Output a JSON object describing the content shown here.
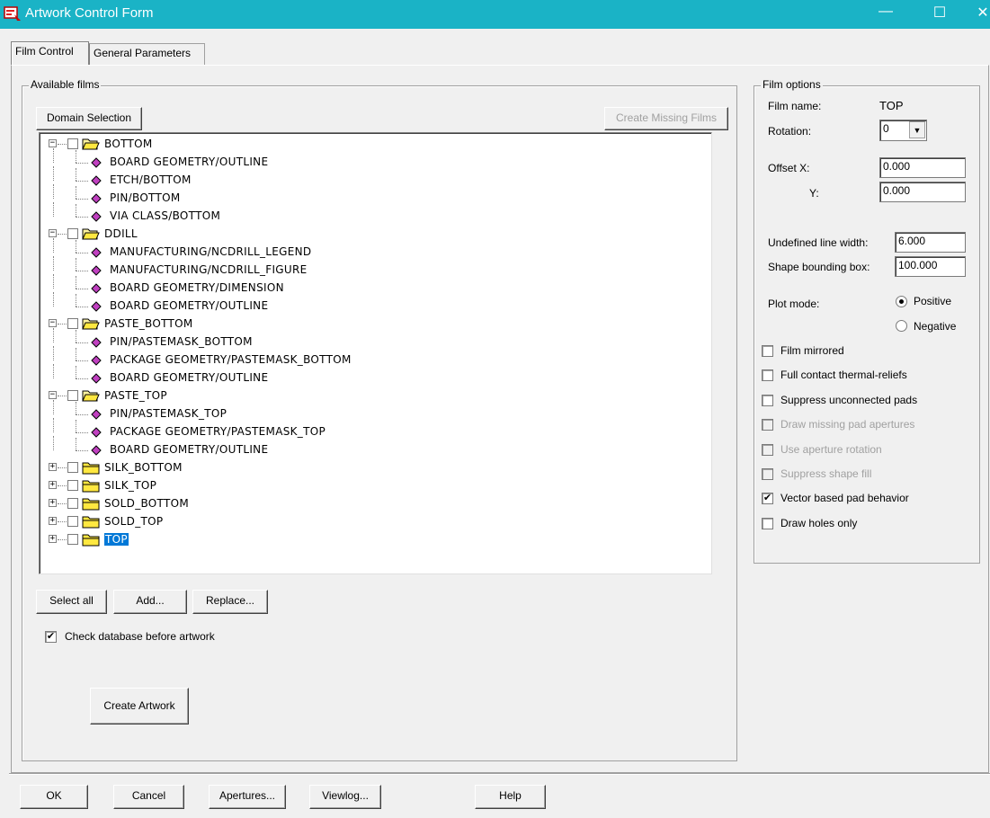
{
  "window": {
    "title": "Artwork Control Form"
  },
  "tabs": [
    "Film Control",
    "General Parameters"
  ],
  "available_films": {
    "legend": "Available films",
    "domain_selection": "Domain Selection",
    "create_missing": "Create Missing Films",
    "tree": [
      {
        "type": "folder",
        "expanded": true,
        "label": "BOTTOM"
      },
      {
        "type": "item",
        "label": "BOARD GEOMETRY/OUTLINE"
      },
      {
        "type": "item",
        "label": "ETCH/BOTTOM"
      },
      {
        "type": "item",
        "label": "PIN/BOTTOM"
      },
      {
        "type": "item",
        "label": "VIA CLASS/BOTTOM"
      },
      {
        "type": "folder",
        "expanded": true,
        "label": "DDILL"
      },
      {
        "type": "item",
        "label": "MANUFACTURING/NCDRILL_LEGEND"
      },
      {
        "type": "item",
        "label": "MANUFACTURING/NCDRILL_FIGURE"
      },
      {
        "type": "item",
        "label": "BOARD GEOMETRY/DIMENSION"
      },
      {
        "type": "item",
        "label": "BOARD GEOMETRY/OUTLINE"
      },
      {
        "type": "folder",
        "expanded": true,
        "label": "PASTE_BOTTOM"
      },
      {
        "type": "item",
        "label": "PIN/PASTEMASK_BOTTOM"
      },
      {
        "type": "item",
        "label": "PACKAGE GEOMETRY/PASTEMASK_BOTTOM"
      },
      {
        "type": "item",
        "label": "BOARD GEOMETRY/OUTLINE"
      },
      {
        "type": "folder",
        "expanded": true,
        "label": "PASTE_TOP"
      },
      {
        "type": "item",
        "label": "PIN/PASTEMASK_TOP"
      },
      {
        "type": "item",
        "label": "PACKAGE GEOMETRY/PASTEMASK_TOP"
      },
      {
        "type": "item",
        "label": "BOARD GEOMETRY/OUTLINE"
      },
      {
        "type": "folder",
        "expanded": false,
        "label": "SILK_BOTTOM"
      },
      {
        "type": "folder",
        "expanded": false,
        "label": "SILK_TOP"
      },
      {
        "type": "folder",
        "expanded": false,
        "label": "SOLD_BOTTOM"
      },
      {
        "type": "folder",
        "expanded": false,
        "label": "SOLD_TOP"
      },
      {
        "type": "folder",
        "expanded": false,
        "label": "TOP",
        "selected": true
      }
    ],
    "select_all": "Select all",
    "add": "Add...",
    "replace": "Replace...",
    "check_db_label": "Check database before artwork",
    "check_db_checked": true,
    "create_artwork": "Create Artwork"
  },
  "film_options": {
    "legend": "Film options",
    "film_name_label": "Film name:",
    "film_name_value": "TOP",
    "rotation_label": "Rotation:",
    "rotation_value": "0",
    "offset_label": "Offset  X:",
    "offset_y_label": "Y:",
    "offset_x": "0.000",
    "offset_y": "0.000",
    "undef_width_label": "Undefined line width:",
    "undef_width": "6.000",
    "shape_bbox_label": "Shape bounding box:",
    "shape_bbox": "100.000",
    "plot_mode_label": "Plot mode:",
    "positive": "Positive",
    "negative": "Negative",
    "plot_mode": "Positive",
    "checkboxes": [
      {
        "label": "Film mirrored",
        "checked": false,
        "enabled": true
      },
      {
        "label": "Full contact thermal-reliefs",
        "checked": false,
        "enabled": true
      },
      {
        "label": "Suppress unconnected pads",
        "checked": false,
        "enabled": true
      },
      {
        "label": "Draw missing pad apertures",
        "checked": false,
        "enabled": false
      },
      {
        "label": "Use aperture rotation",
        "checked": false,
        "enabled": false
      },
      {
        "label": "Suppress shape fill",
        "checked": false,
        "enabled": false
      },
      {
        "label": "Vector based pad behavior",
        "checked": true,
        "enabled": true
      },
      {
        "label": "Draw holes only",
        "checked": false,
        "enabled": true
      }
    ]
  },
  "footer": {
    "ok": "OK",
    "cancel": "Cancel",
    "apertures": "Apertures...",
    "viewlog": "Viewlog...",
    "help": "Help"
  },
  "icons": {
    "window": "app-icon",
    "folder": "folder-icon",
    "item": "film-layer-icon"
  },
  "colors": {
    "titlebar": "#1ab3c6",
    "selection": "#0078d7",
    "layer_icon": "#c040c0"
  }
}
